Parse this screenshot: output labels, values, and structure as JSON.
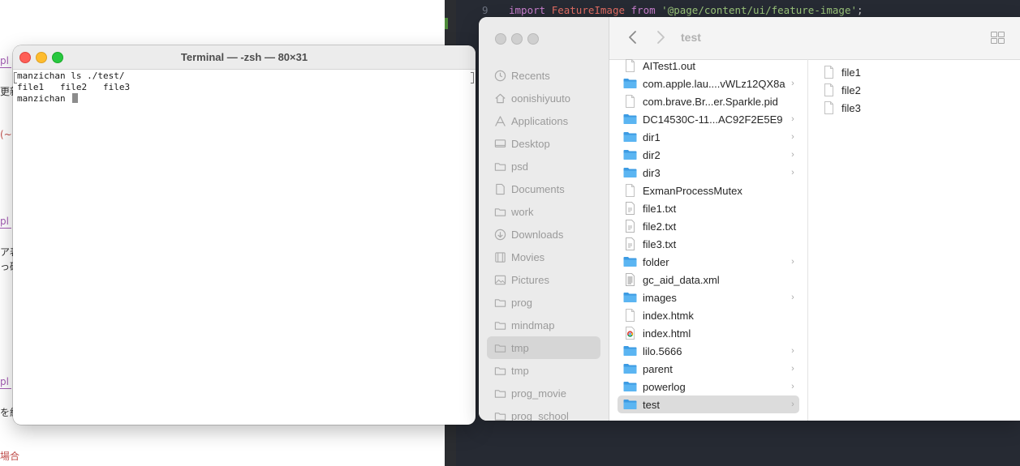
{
  "editor": {
    "line_number": "9",
    "code_import": "import",
    "code_identifier": "FeatureImage",
    "code_from": "from",
    "code_string": "'@page/content/ui/feature-image'",
    "code_semicolon": ";"
  },
  "left_fragments": {
    "f1": "pl",
    "f2": "更新",
    "f3": "(~",
    "f4": "pl",
    "f5": "ア表",
    "f6": "っ確",
    "f7": "pl",
    "f8": "を組",
    "f9": "場合"
  },
  "terminal": {
    "title": "Terminal — -zsh — 80×31",
    "lines": [
      "manzichan ls ./test/",
      "file1   file2   file3",
      "manzichan "
    ]
  },
  "finder": {
    "title": "test",
    "sidebar": [
      {
        "label": "Recents",
        "icon": "clock-icon",
        "selected": false
      },
      {
        "label": "oonishiyuuto",
        "icon": "home-icon",
        "selected": false
      },
      {
        "label": "Applications",
        "icon": "applications-icon",
        "selected": false
      },
      {
        "label": "Desktop",
        "icon": "desktop-icon",
        "selected": false
      },
      {
        "label": "psd",
        "icon": "folder-icon",
        "selected": false
      },
      {
        "label": "Documents",
        "icon": "document-icon",
        "selected": false
      },
      {
        "label": "work",
        "icon": "folder-icon",
        "selected": false
      },
      {
        "label": "Downloads",
        "icon": "download-icon",
        "selected": false
      },
      {
        "label": "Movies",
        "icon": "film-icon",
        "selected": false
      },
      {
        "label": "Pictures",
        "icon": "photo-icon",
        "selected": false
      },
      {
        "label": "prog",
        "icon": "folder-icon",
        "selected": false
      },
      {
        "label": "mindmap",
        "icon": "folder-icon",
        "selected": false
      },
      {
        "label": "tmp",
        "icon": "folder-icon",
        "selected": true
      },
      {
        "label": "tmp",
        "icon": "folder-icon",
        "selected": false
      },
      {
        "label": "prog_movie",
        "icon": "folder-icon",
        "selected": false
      },
      {
        "label": "prog_school",
        "icon": "folder-icon",
        "selected": false
      }
    ],
    "column1": [
      {
        "label": "AITest1.out",
        "kind": "file",
        "chevron": false,
        "selected": false
      },
      {
        "label": "com.apple.lau....vWLz12QX8a",
        "kind": "folder",
        "chevron": true,
        "selected": false
      },
      {
        "label": "com.brave.Br...er.Sparkle.pid",
        "kind": "file",
        "chevron": false,
        "selected": false
      },
      {
        "label": "DC14530C-11...AC92F2E5E9",
        "kind": "folder",
        "chevron": true,
        "selected": false
      },
      {
        "label": "dir1",
        "kind": "folder",
        "chevron": true,
        "selected": false
      },
      {
        "label": "dir2",
        "kind": "folder",
        "chevron": true,
        "selected": false
      },
      {
        "label": "dir3",
        "kind": "folder",
        "chevron": true,
        "selected": false
      },
      {
        "label": "ExmanProcessMutex",
        "kind": "file",
        "chevron": false,
        "selected": false
      },
      {
        "label": "file1.txt",
        "kind": "text",
        "chevron": false,
        "selected": false
      },
      {
        "label": "file2.txt",
        "kind": "text",
        "chevron": false,
        "selected": false
      },
      {
        "label": "file3.txt",
        "kind": "text",
        "chevron": false,
        "selected": false
      },
      {
        "label": "folder",
        "kind": "folder",
        "chevron": true,
        "selected": false
      },
      {
        "label": "gc_aid_data.xml",
        "kind": "xml",
        "chevron": false,
        "selected": false
      },
      {
        "label": "images",
        "kind": "folder",
        "chevron": true,
        "selected": false
      },
      {
        "label": "index.htmk",
        "kind": "file",
        "chevron": false,
        "selected": false
      },
      {
        "label": "index.html",
        "kind": "chrome",
        "chevron": false,
        "selected": false
      },
      {
        "label": "lilo.5666",
        "kind": "folder",
        "chevron": true,
        "selected": false
      },
      {
        "label": "parent",
        "kind": "folder",
        "chevron": true,
        "selected": false
      },
      {
        "label": "powerlog",
        "kind": "folder",
        "chevron": true,
        "selected": false
      },
      {
        "label": "test",
        "kind": "folder",
        "chevron": true,
        "selected": true
      }
    ],
    "column2": [
      {
        "label": "file1",
        "kind": "file"
      },
      {
        "label": "file2",
        "kind": "file"
      },
      {
        "label": "file3",
        "kind": "file"
      }
    ],
    "chevron_glyph": "›"
  },
  "colors": {
    "folder_blue": "#4aa8e8",
    "selected_gray": "#dcdcdc"
  }
}
